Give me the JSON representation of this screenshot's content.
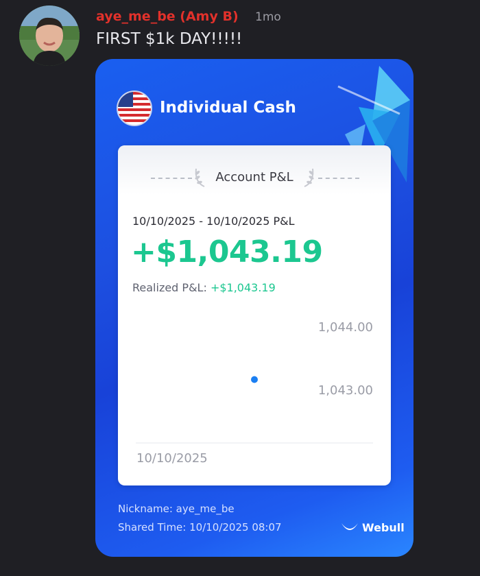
{
  "post": {
    "username": "aye_me_be (Amy B)",
    "age": "1mo",
    "text": "FIRST $1k DAY!!!!!"
  },
  "card": {
    "account": "Individual Cash",
    "panel_title": "Account P&L",
    "date_range": "10/10/2025 - 10/10/2025 P&L",
    "pl_value": "+$1,043.19",
    "realized_label": "Realized P&L: ",
    "realized_value": "+$1,043.19",
    "nickname": "Nickname: aye_me_be",
    "shared_time": "Shared Time: 10/10/2025 08:07",
    "brand": "Webull",
    "icons": {
      "flag": "us-flag-icon",
      "brand": "webull-logo-icon",
      "laurel": "laurel-icon"
    }
  },
  "chart_data": {
    "type": "scatter",
    "x": [
      "10/10/2025"
    ],
    "y": [
      1043.19
    ],
    "xlabel": "",
    "ylabel": "",
    "y_ticks": [
      "1,044.00",
      "1,043.00"
    ],
    "x_ticks": [
      "10/10/2025"
    ],
    "ylim": [
      1042.82,
      1044.0
    ],
    "color": "#1b7ff2"
  },
  "colors": {
    "username": "#e2312b",
    "profit": "#1cc790",
    "card_blue": "#1d4fe0",
    "point": "#1b7ff2"
  }
}
